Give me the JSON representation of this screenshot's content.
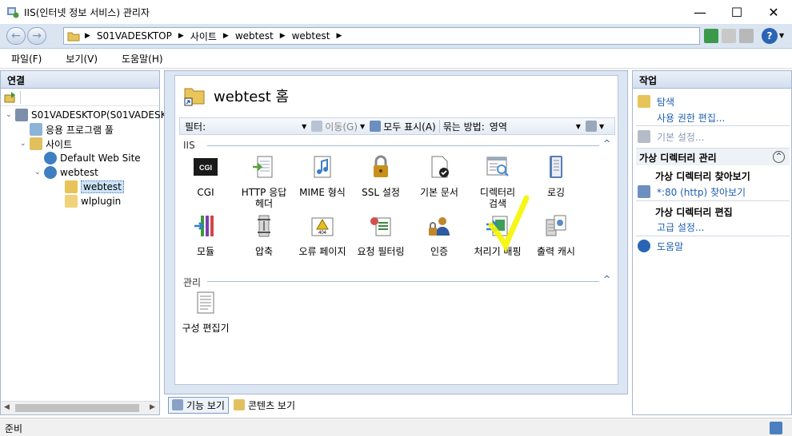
{
  "window": {
    "title": "IIS(인터넷 정보 서비스) 관리자",
    "minimize": "—",
    "maximize": "☐",
    "close": "✕"
  },
  "address": {
    "crumbs": [
      "S01VADESKTOP",
      "사이트",
      "webtest",
      "webtest"
    ]
  },
  "menu": {
    "file": "파일(F)",
    "view": "보기(V)",
    "help": "도움말(H)"
  },
  "left": {
    "header": "연결",
    "tree": [
      {
        "label": "S01VADESKTOP(S01VADESKT",
        "icon": "server-icon"
      },
      {
        "label": "응용 프로그램 풀",
        "icon": "app-pool-icon"
      },
      {
        "label": "사이트",
        "icon": "sites-folder-icon"
      },
      {
        "label": "Default Web Site",
        "icon": "globe-icon"
      },
      {
        "label": "webtest",
        "icon": "globe-icon"
      },
      {
        "label": "webtest",
        "icon": "folder-icon"
      },
      {
        "label": "wlplugin",
        "icon": "folder-icon"
      }
    ]
  },
  "center": {
    "title": "webtest 홈",
    "filter": {
      "label": "필터:",
      "value": "",
      "go": "이동(G)",
      "show_all": "모두 표시(A)",
      "group_by_label": "묶는 방법:",
      "group_by_value": "영역"
    },
    "groups": {
      "iis": "IIS",
      "manage": "관리"
    },
    "features": [
      {
        "label": "CGI",
        "icon": "cgi-icon",
        "color": "#1a1a1a"
      },
      {
        "label": "HTTP 응답\n헤더",
        "icon": "http-response-headers-icon",
        "color": "#5aa03c"
      },
      {
        "label": "MIME 형식",
        "icon": "mime-types-icon",
        "color": "#3d7ec9"
      },
      {
        "label": "SSL 설정",
        "icon": "lock-icon",
        "color": "#c8901c"
      },
      {
        "label": "기본 문서",
        "icon": "default-document-icon",
        "color": "#444444"
      },
      {
        "label": "디렉터리\n검색",
        "icon": "directory-browsing-icon",
        "color": "#4f8fd6"
      },
      {
        "label": "로깅",
        "icon": "logging-icon",
        "color": "#5b7db8"
      },
      {
        "label": "모듈",
        "icon": "modules-icon",
        "color": "#7a3fb0"
      },
      {
        "label": "압축",
        "icon": "compression-icon",
        "color": "#8c8c8c"
      },
      {
        "label": "오류 페이지",
        "icon": "error-pages-icon",
        "color": "#e8c020"
      },
      {
        "label": "요청 필터링",
        "icon": "request-filtering-icon",
        "color": "#3a8a3a"
      },
      {
        "label": "인증",
        "icon": "authentication-icon",
        "color": "#c0882a"
      },
      {
        "label": "처리기 매핑",
        "icon": "handler-mappings-icon",
        "color": "#3e9e5a"
      },
      {
        "label": "출력 캐시",
        "icon": "output-caching-icon",
        "color": "#5c8cc0"
      }
    ],
    "manage_features": [
      {
        "label": "구성 편집기",
        "icon": "configuration-editor-icon",
        "color": "#7a7a7a"
      }
    ],
    "tabs": {
      "features_view": "기능 보기",
      "content_view": "콘텐츠 보기"
    }
  },
  "right": {
    "header": "작업",
    "explore": "탐색",
    "edit_permissions": "사용 권한 편집...",
    "basic_settings": "기본 설정...",
    "vdir_section": "가상 디렉터리 관리",
    "browse_title": "가상 디렉터리 찾아보기",
    "browse_link": "*:80 (http) 찾아보기",
    "edit_title": "가상 디렉터리 편집",
    "advanced": "고급 설정...",
    "help": "도움말"
  },
  "status": {
    "text": "준비"
  },
  "colors": {
    "link": "#1d5fb0",
    "annotation": "#f5f500"
  }
}
